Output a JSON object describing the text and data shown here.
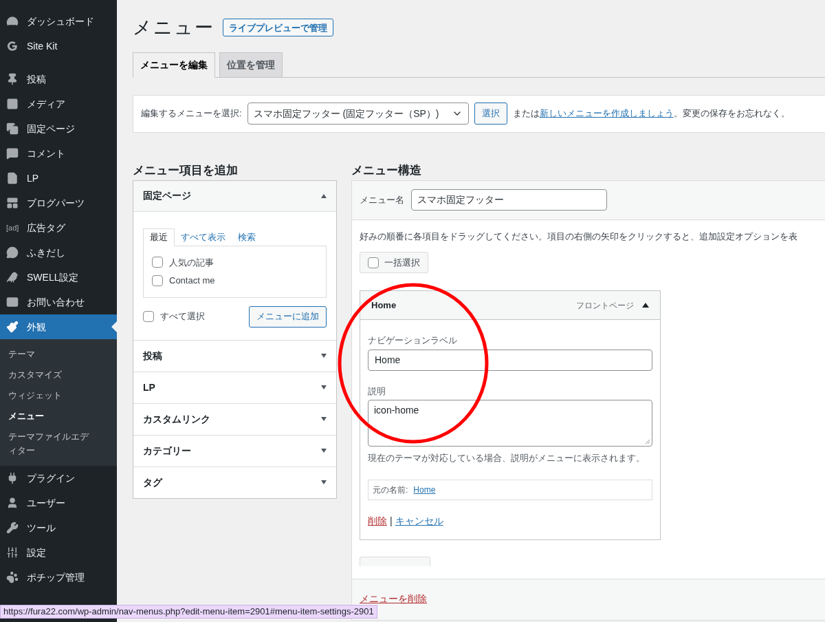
{
  "sidebar": {
    "sections": [
      {
        "items": [
          {
            "label": "ダッシュボード",
            "selected": false
          },
          {
            "label": "Site Kit",
            "selected": false
          }
        ]
      },
      {
        "items": [
          {
            "label": "投稿",
            "selected": false
          },
          {
            "label": "メディア",
            "selected": false
          },
          {
            "label": "固定ページ",
            "selected": false
          },
          {
            "label": "コメント",
            "selected": false
          },
          {
            "label": "LP",
            "selected": false
          },
          {
            "label": "ブログパーツ",
            "selected": false
          },
          {
            "label": "広告タグ",
            "selected": false,
            "icon_text": "[ad]"
          },
          {
            "label": "ふきだし",
            "selected": false
          },
          {
            "label": "SWELL設定",
            "selected": false
          },
          {
            "label": "お問い合わせ",
            "selected": false
          },
          {
            "label": "外観",
            "selected": true,
            "submenu": [
              {
                "label": "テーマ",
                "selected": false
              },
              {
                "label": "カスタマイズ",
                "selected": false
              },
              {
                "label": "ウィジェット",
                "selected": false
              },
              {
                "label": "メニュー",
                "selected": true
              },
              {
                "label": "テーマファイルエディター",
                "selected": false
              }
            ]
          },
          {
            "label": "プラグイン",
            "selected": false
          },
          {
            "label": "ユーザー",
            "selected": false
          },
          {
            "label": "ツール",
            "selected": false
          },
          {
            "label": "設定",
            "selected": false
          },
          {
            "label": "ポチップ管理",
            "selected": false
          }
        ]
      }
    ]
  },
  "header": {
    "title": "メニュー",
    "live_preview_button": "ライブプレビューで管理",
    "tabs": [
      {
        "label": "メニューを編集",
        "selected": true
      },
      {
        "label": "位置を管理",
        "selected": false
      }
    ]
  },
  "select_bar": {
    "label": "編集するメニューを選択:",
    "select_value": "スマホ固定フッター (固定フッター（SP）)",
    "button": "選択",
    "text_before": "または",
    "link": "新しいメニューを作成しましょう",
    "text_after": "。変更の保存をお忘れなく。"
  },
  "add_items": {
    "heading": "メニュー項目を追加",
    "panels": [
      {
        "title": "固定ページ",
        "expanded": true,
        "tabs": [
          {
            "label": "最近",
            "selected": true
          },
          {
            "label": "すべて表示",
            "selected": false
          },
          {
            "label": "検索",
            "selected": false
          }
        ],
        "items": [
          {
            "label": "人気の記事",
            "checked": false
          },
          {
            "label": "Contact me",
            "checked": false
          }
        ],
        "select_all": {
          "label": "すべて選択",
          "checked": false
        },
        "add_button": "メニューに追加"
      },
      {
        "title": "投稿",
        "expanded": false
      },
      {
        "title": "LP",
        "expanded": false
      },
      {
        "title": "カスタムリンク",
        "expanded": false
      },
      {
        "title": "カテゴリー",
        "expanded": false
      },
      {
        "title": "タグ",
        "expanded": false
      }
    ]
  },
  "structure": {
    "heading": "メニュー構造",
    "name_label": "メニュー名",
    "name_value": "スマホ固定フッター",
    "instructions": "好みの順番に各項目をドラッグしてください。項目の右側の矢印をクリックすると、追加設定オプションを表",
    "bulk_select": {
      "label": "一括選択",
      "checked": false
    },
    "menu_items": [
      {
        "title": "Home",
        "type": "フロントページ",
        "expanded": true,
        "nav_label_caption": "ナビゲーションラベル",
        "nav_label_value": "Home",
        "description_caption": "説明",
        "description_value": "icon-home",
        "help": "現在のテーマが対応している場合、説明がメニューに表示されます。",
        "original_label": "元の名前:",
        "original_link": "Home",
        "delete_link": "削除",
        "separator": "|",
        "cancel_link": "キャンセル"
      }
    ],
    "delete_menu_link": "メニューを削除"
  },
  "status_url": "https://fura22.com/wp-admin/nav-menus.php?edit-menu-item=2901#menu-item-settings-2901"
}
